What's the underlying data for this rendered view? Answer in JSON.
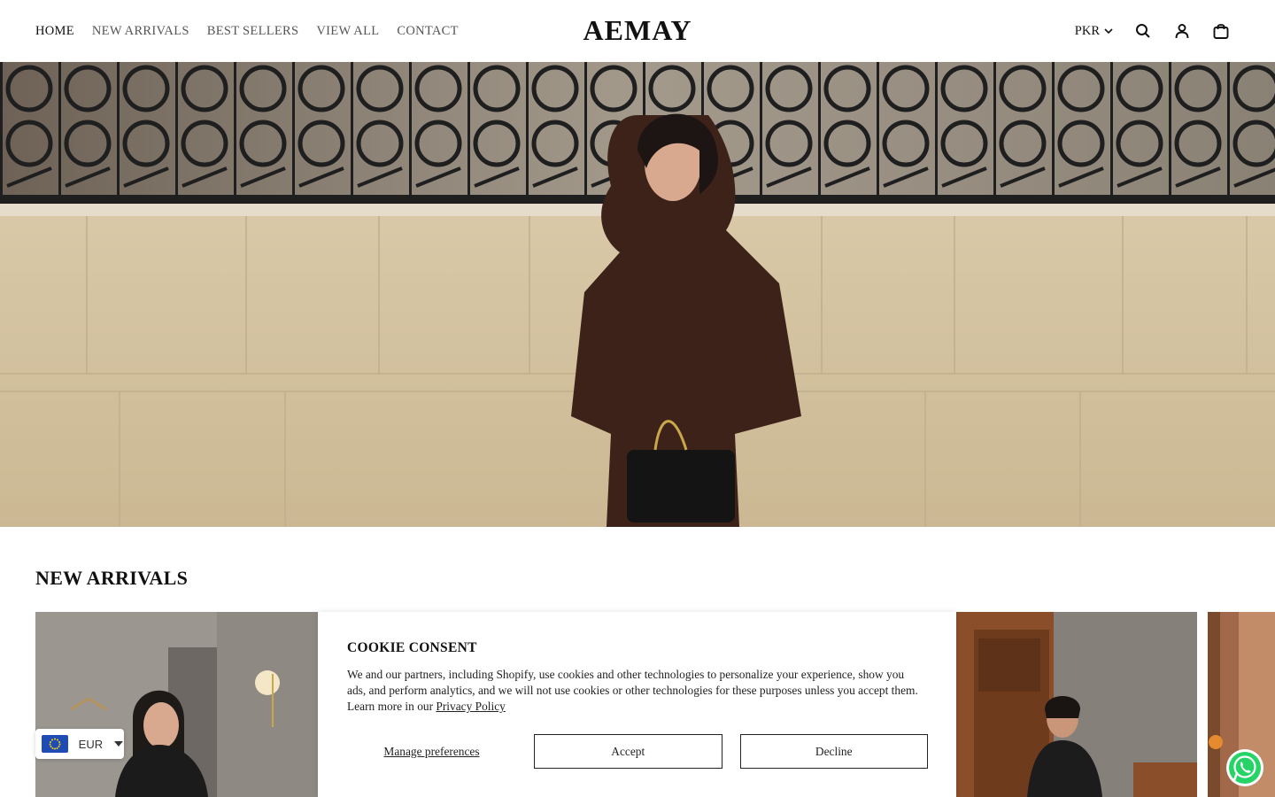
{
  "header": {
    "nav": [
      {
        "label": "HOME",
        "active": true
      },
      {
        "label": "NEW ARRIVALS",
        "active": false
      },
      {
        "label": "BEST SELLERS",
        "active": false
      },
      {
        "label": "VIEW ALL",
        "active": false
      },
      {
        "label": "CONTACT",
        "active": false
      }
    ],
    "logo": "AEMAY",
    "currency": "PKR",
    "icons": [
      "chevron-down-icon",
      "search-icon",
      "account-icon",
      "cart-icon"
    ]
  },
  "hero": {
    "image": "woman-in-brown-dress-with-black-handbag"
  },
  "section": {
    "title": "NEW ARRIVALS"
  },
  "products": [
    {
      "image": "woman-in-black-dress-marble-room"
    },
    {
      "image": "woman-in-black-top-wooden-shelves"
    },
    {
      "image": "woman-in-orange-wooden-door"
    }
  ],
  "cookie": {
    "title": "COOKIE CONSENT",
    "text": "We and our partners, including Shopify, use cookies and other technologies to personalize your experience, show you ads, and perform analytics, and we will not use cookies or other technologies for these purposes unless you accept them. Learn more in our ",
    "link": "Privacy Policy",
    "manage": "Manage preferences",
    "accept": "Accept",
    "decline": "Decline"
  },
  "currency_selector": {
    "code": "EUR",
    "flag": "eu-flag-icon"
  },
  "colors": {
    "text": "#111111",
    "nav_inactive": "#555555",
    "whatsapp": "#25D366"
  }
}
